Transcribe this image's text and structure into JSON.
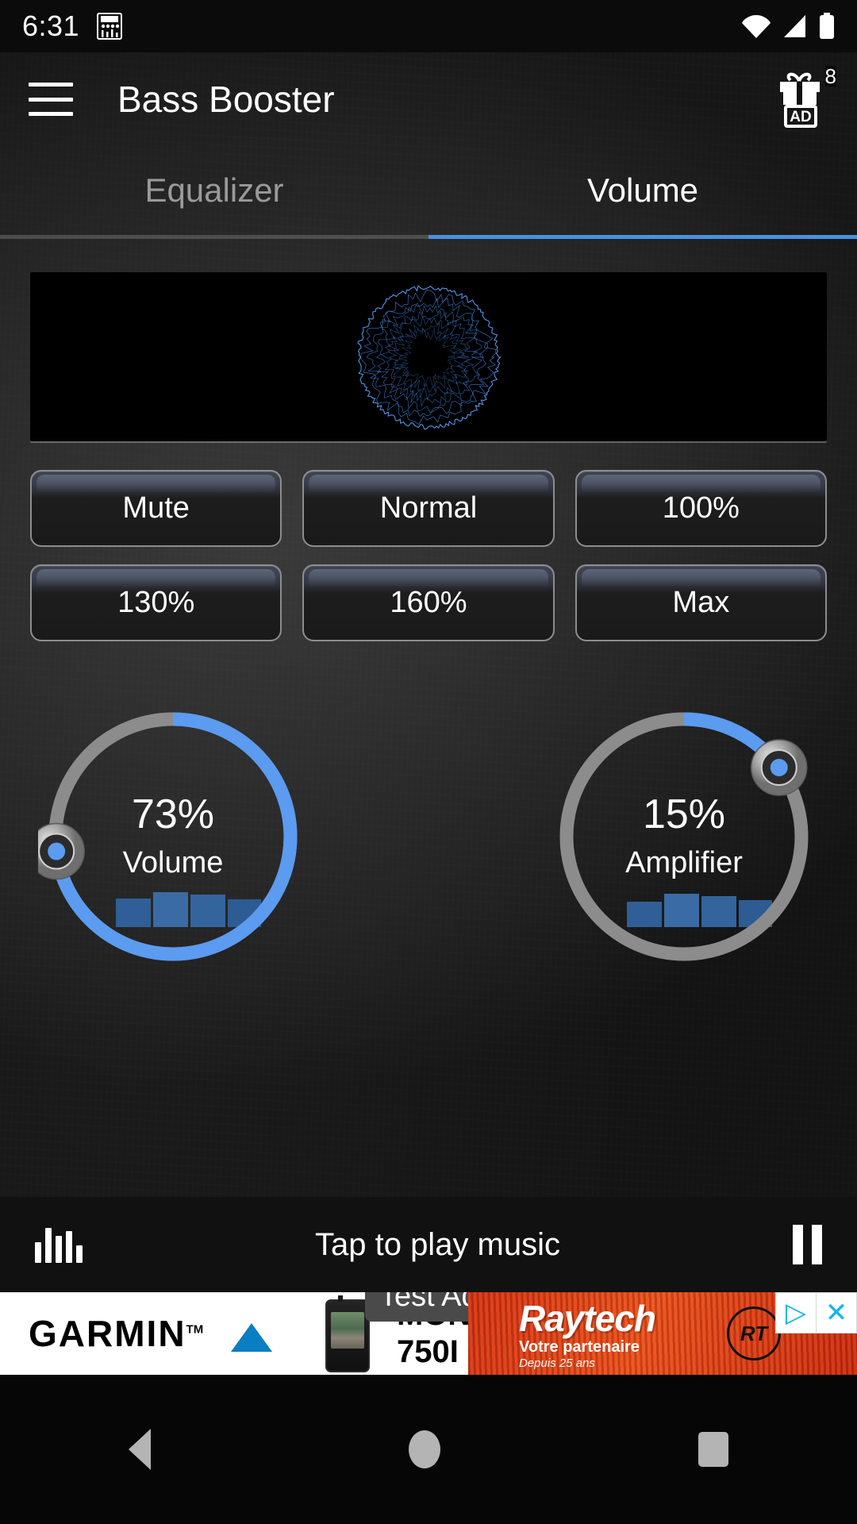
{
  "status_bar": {
    "time": "6:31",
    "icons": [
      "equalizer-notification-icon",
      "wifi-icon",
      "signal-icon",
      "battery-icon"
    ]
  },
  "app_bar": {
    "menu_icon": "hamburger-menu-icon",
    "title": "Bass Booster",
    "gift_icon": "gift-ad-icon",
    "gift_badge": "8",
    "gift_label": "AD"
  },
  "tabs": [
    {
      "label": "Equalizer",
      "active": false
    },
    {
      "label": "Volume",
      "active": true
    }
  ],
  "visualizer": {
    "name": "circular-audio-visualizer",
    "color": "#3f7fd4"
  },
  "presets": {
    "rows": [
      [
        {
          "label": "Mute"
        },
        {
          "label": "Normal"
        },
        {
          "label": "100%"
        }
      ],
      [
        {
          "label": "130%"
        },
        {
          "label": "160%"
        },
        {
          "label": "Max"
        }
      ]
    ]
  },
  "dials": [
    {
      "name": "volume-dial",
      "value": "73%",
      "label": "Volume",
      "percent": 73,
      "arc_color": "#5b9bf0",
      "track_color": "#8c8c8c"
    },
    {
      "name": "amplifier-dial",
      "value": "15%",
      "label": "Amplifier",
      "percent": 15,
      "arc_color": "#5b9bf0",
      "track_color": "#8c8c8c"
    }
  ],
  "player_bar": {
    "left_icon": "equalizer-bars-icon",
    "text": "Tap to play music",
    "right_icon": "pause-icon"
  },
  "ad": {
    "test_chip": "Test Ad",
    "left": {
      "brand": "GARMIN",
      "trademark": "TM",
      "title": "MONTANA®",
      "subtitle": "750I"
    },
    "right": {
      "brand": "Raytech",
      "tagline": "Votre partenaire",
      "since": "Depuis 25 ans",
      "logo_text": "RT",
      "controls": [
        "ad-info-icon",
        "close-icon"
      ]
    }
  },
  "nav_bar": {
    "items": [
      "back-button",
      "home-button",
      "recents-button"
    ]
  },
  "colors": {
    "accent": "#4a90e2",
    "arc": "#5b9bf0",
    "visualizer": "#3f7fd4",
    "background": "#2a2a2a"
  }
}
